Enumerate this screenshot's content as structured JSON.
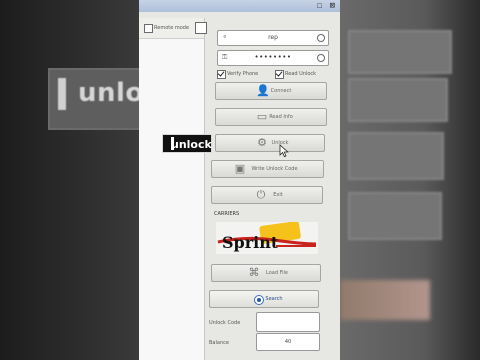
{
  "overlay": {
    "caption": "unlock"
  },
  "background": {
    "caption_mirror": "unlock"
  },
  "window": {
    "title_buttons": "☐ ⊠"
  },
  "left_pane": {
    "header_checkbox_label": "Remote mode"
  },
  "login": {
    "username_value": "rep",
    "password_value": "••••••••",
    "option_1": "Verify Phone",
    "option_2": "Read Unlock"
  },
  "buttons": {
    "connect": "Connect",
    "read_info": "Read Info",
    "unlock": "Unlock",
    "write_unlock_code": "Write Unlock Code",
    "exit": "Exit",
    "load_file": "Load File",
    "start": "Search"
  },
  "carrier": {
    "label": "CARRIERS",
    "logo_text": "Sprint"
  },
  "unlock_code": {
    "label": "Unlock Code",
    "value": ""
  },
  "balance": {
    "label": "Balance",
    "value": "40"
  },
  "colors": {
    "window_bg": "#e7e7e3",
    "logo_red": "#c8231c",
    "logo_yellow": "#f4c21b",
    "radio_blue": "#1f57a8"
  }
}
